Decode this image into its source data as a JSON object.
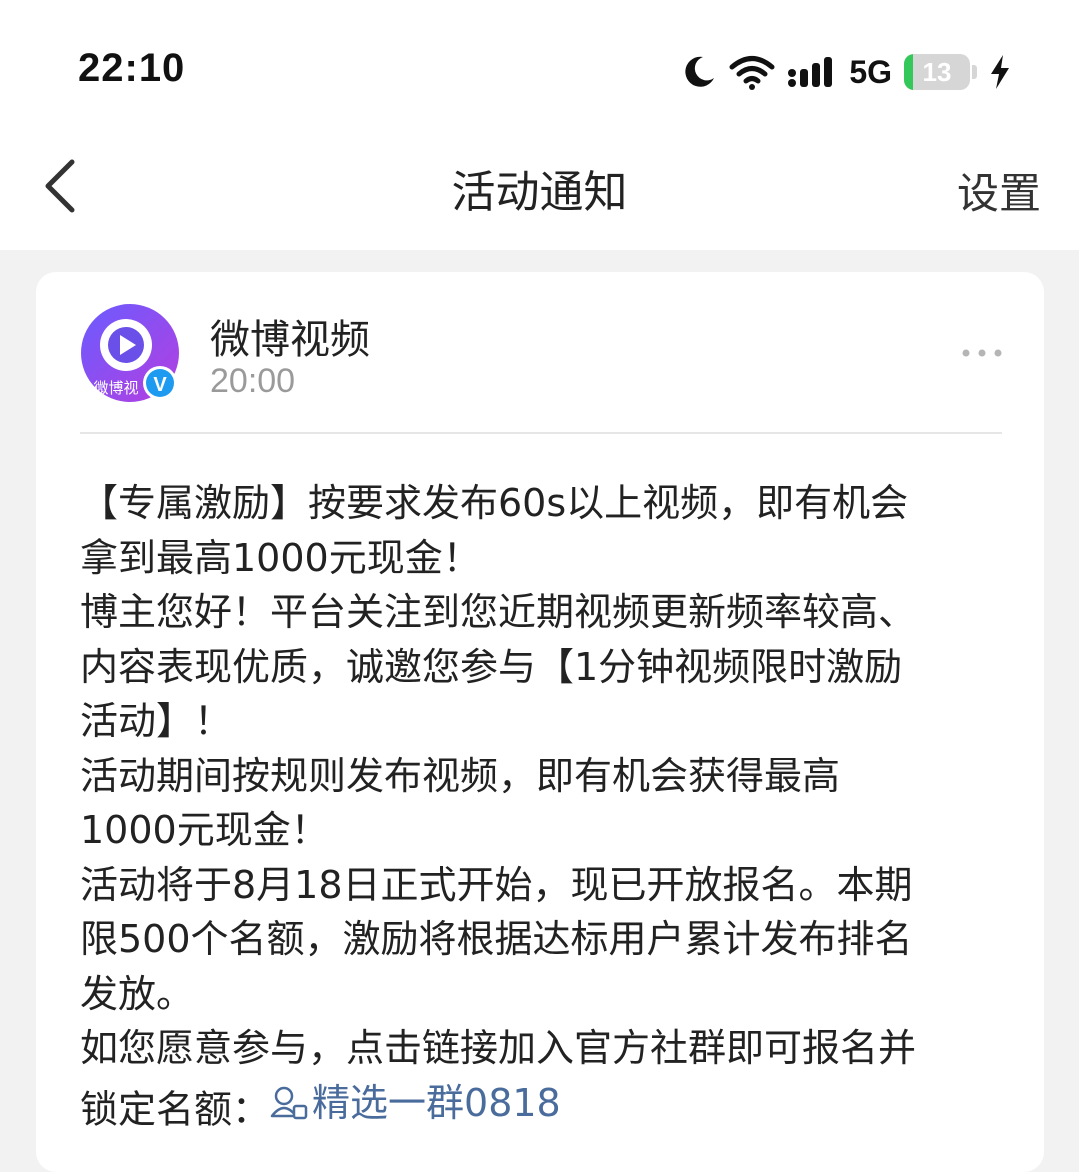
{
  "status_bar": {
    "time": "22:10",
    "network": "5G",
    "battery_level": "13",
    "icons": [
      "moon-icon",
      "wifi-icon",
      "signal-icon",
      "battery-icon",
      "charging-icon"
    ]
  },
  "nav": {
    "title": "活动通知",
    "right_label": "设置",
    "back_icon": "chevron-left-icon"
  },
  "message": {
    "sender_name": "微博视频",
    "avatar_text": "微博视",
    "time": "20:00",
    "verified_badge": "V",
    "lines": [
      "【专属激励】按要求发布60s以上视频，即有机会",
      "拿到最高1000元现金！",
      "博主您好！平台关注到您近期视频更新频率较高、",
      "内容表现优质，诚邀您参与【1分钟视频限时激励",
      "活动】！",
      "活动期间按规则发布视频，即有机会获得最高",
      "1000元现金！",
      "活动将于8月18日正式开始，现已开放报名。本期",
      "限500个名额，激励将根据达标用户累计发布排名",
      "发放。",
      "如您愿意参与，点击链接加入官方社群即可报名并"
    ],
    "last_line_prefix": "锁定名额：",
    "link_text": "精选一群0818"
  },
  "colors": {
    "link": "#4a6c9c",
    "battery_fill": "#34c759",
    "verified": "#1e9bf0",
    "avatar_ring": "#8a3ee0"
  }
}
